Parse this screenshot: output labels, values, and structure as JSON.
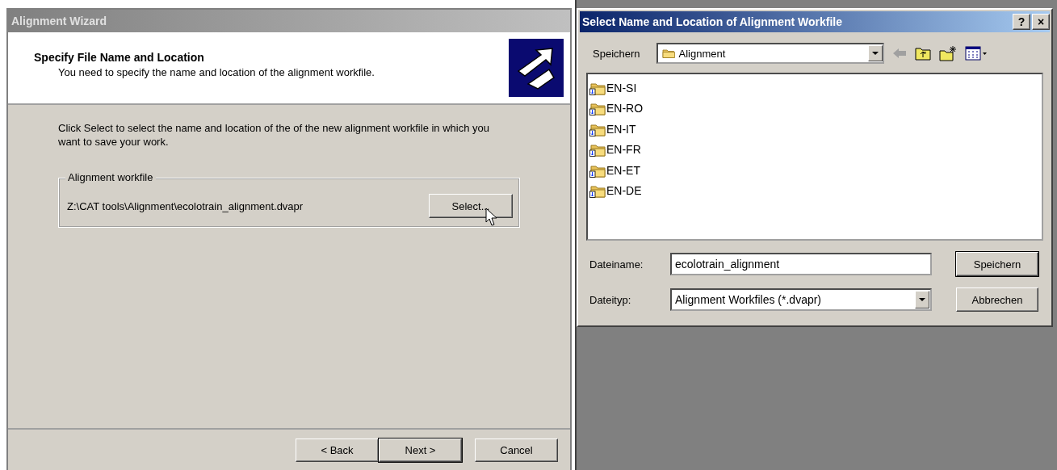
{
  "wizard": {
    "title": "Alignment Wizard",
    "heading": "Specify File Name and Location",
    "subheading": "You need to specify the name and location of the alignment workfile.",
    "instructions": "Click Select to select the name and location of the of the new alignment workfile in which you want to save your work.",
    "group": {
      "label": "Alignment workfile",
      "path": "Z:\\CAT tools\\Alignment\\ecolotrain_alignment.dvapr",
      "button": "Select..."
    },
    "buttons": [
      {
        "label": "< Back",
        "default": false
      },
      {
        "label": "Next >",
        "default": true
      },
      {
        "label": "Cancel",
        "default": false
      }
    ]
  },
  "dialog": {
    "title": "Select Name and Location of Alignment Workfile",
    "title_buttons": [
      "?",
      "×"
    ],
    "location_label": "Speichern",
    "location": "Alignment",
    "items": [
      {
        "name": "EN-SI"
      },
      {
        "name": "EN-RO"
      },
      {
        "name": "EN-IT"
      },
      {
        "name": "EN-FR"
      },
      {
        "name": "EN-ET"
      },
      {
        "name": "EN-DE"
      }
    ],
    "filename_label": "Dateiname:",
    "filename": "ecolotrain_alignment",
    "filetype_label": "Dateityp:",
    "filetype": "Alignment Workfiles (*.dvapr)",
    "buttons": [
      {
        "label": "Speichern",
        "default": true
      },
      {
        "label": "Abbrechen",
        "default": false
      }
    ]
  }
}
